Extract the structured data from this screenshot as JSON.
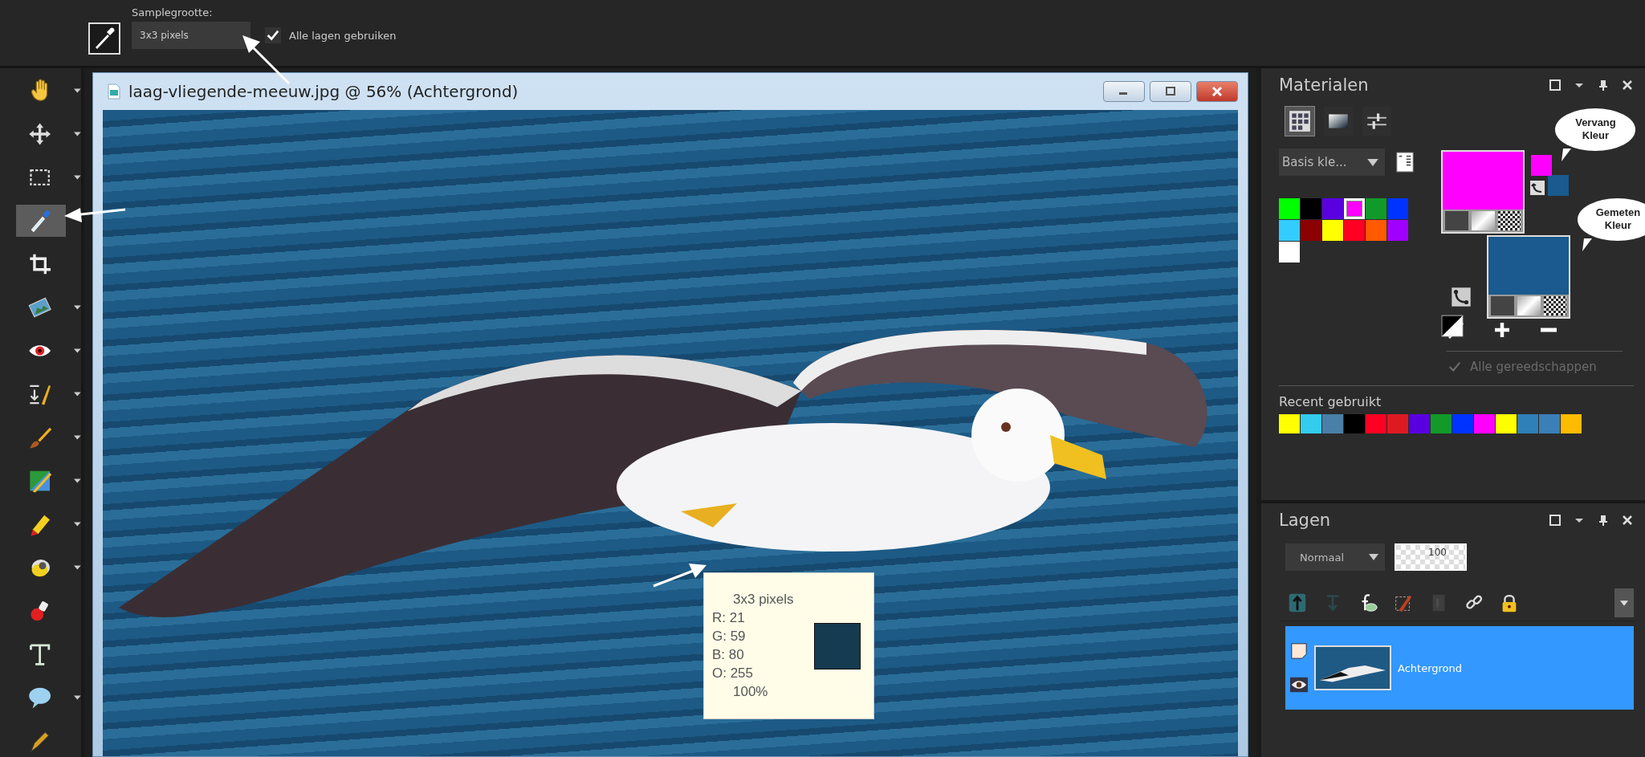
{
  "tool_options": {
    "label": "Samplegrootte:",
    "sample_size": "3x3 pixels",
    "use_all_layers": {
      "label": "Alle lagen gebruiken",
      "checked": true
    }
  },
  "tools": [
    {
      "kind": "hand",
      "selected": false,
      "menu": true
    },
    {
      "kind": "move",
      "selected": false,
      "menu": true
    },
    {
      "kind": "selection",
      "selected": false,
      "menu": true
    },
    {
      "kind": "dropper",
      "selected": true,
      "menu": false
    },
    {
      "kind": "crop",
      "selected": false,
      "menu": false
    },
    {
      "kind": "picture",
      "selected": false,
      "menu": true
    },
    {
      "kind": "redeye",
      "selected": false,
      "menu": true
    },
    {
      "kind": "retouch",
      "selected": false,
      "menu": true
    },
    {
      "kind": "brush",
      "selected": false,
      "menu": true
    },
    {
      "kind": "changer",
      "selected": false,
      "menu": true
    },
    {
      "kind": "pencil",
      "selected": false,
      "menu": true
    },
    {
      "kind": "fill",
      "selected": false,
      "menu": true
    },
    {
      "kind": "stamp",
      "selected": false,
      "menu": false
    },
    {
      "kind": "text",
      "selected": false,
      "menu": false
    },
    {
      "kind": "bubble",
      "selected": false,
      "menu": true
    },
    {
      "kind": "pen",
      "selected": false,
      "menu": false
    }
  ],
  "document": {
    "title": "laag-vliegende-meeuw.jpg @  56% (Achtergrond)"
  },
  "tooltip": {
    "title": "3x3 pixels",
    "lines": [
      "R: 21",
      "G: 59",
      "B: 80",
      "O: 255"
    ],
    "zoom": "100%",
    "color": "#153b50"
  },
  "materials": {
    "title": "Materialen",
    "tabs": [
      {
        "kind": "swatches",
        "selected": true
      },
      {
        "kind": "gradient",
        "selected": false
      },
      {
        "kind": "sliders",
        "selected": false
      }
    ],
    "palette": "Basis kle...",
    "swatches": [
      {
        "color": "#00ff00",
        "selected": false
      },
      {
        "color": "#000000",
        "selected": false
      },
      {
        "color": "#5a00e0",
        "selected": false
      },
      {
        "color": "#ff00ff",
        "selected": true
      },
      {
        "color": "#119a2a",
        "selected": false
      },
      {
        "color": "#0033ff",
        "selected": false
      },
      {
        "color": "#33ccff",
        "selected": false
      },
      {
        "color": "#8b0000",
        "selected": false
      },
      {
        "color": "#ffff00",
        "selected": false
      },
      {
        "color": "#ff0022",
        "selected": false
      },
      {
        "color": "#ff5a00",
        "selected": false
      },
      {
        "color": "#a000ff",
        "selected": false
      },
      {
        "color": "#ffffff",
        "selected": false
      }
    ],
    "foreground": {
      "color": "#ff00ff"
    },
    "background": {
      "color": "#1a5a8e"
    },
    "callouts": [
      "Vervang Kleur",
      "Gemeten Kleur"
    ],
    "all_tools": {
      "label": "Alle gereedschappen",
      "checked": true,
      "disabled": true
    },
    "recent_title": "Recent gebruikt",
    "recent": [
      {
        "color": "#ffff00"
      },
      {
        "color": "#33ccee"
      },
      {
        "color": "#4a7fa8"
      },
      {
        "color": "#000000"
      },
      {
        "color": "#ff0022"
      },
      {
        "color": "#dd1a22"
      },
      {
        "color": "#5a00e0"
      },
      {
        "color": "#119a2a"
      },
      {
        "color": "#0033ff"
      },
      {
        "color": "#ff00ff"
      },
      {
        "color": "#ffff00"
      },
      {
        "color": "#2f7fb8"
      },
      {
        "color": "#3a7fb8"
      },
      {
        "color": "#ffbb00"
      }
    ]
  },
  "layers": {
    "title": "Lagen",
    "blend_mode": "Normaal",
    "opacity": "100",
    "tools": [
      {
        "kind": "raster",
        "disabled": false
      },
      {
        "kind": "vector",
        "disabled": true
      },
      {
        "kind": "fx",
        "disabled": false
      },
      {
        "kind": "mask",
        "disabled": false
      },
      {
        "kind": "delete",
        "disabled": true
      },
      {
        "kind": "link",
        "disabled": false
      },
      {
        "kind": "lock",
        "disabled": false
      }
    ],
    "items": [
      {
        "name": "Achtergrond",
        "selected": true
      }
    ]
  }
}
